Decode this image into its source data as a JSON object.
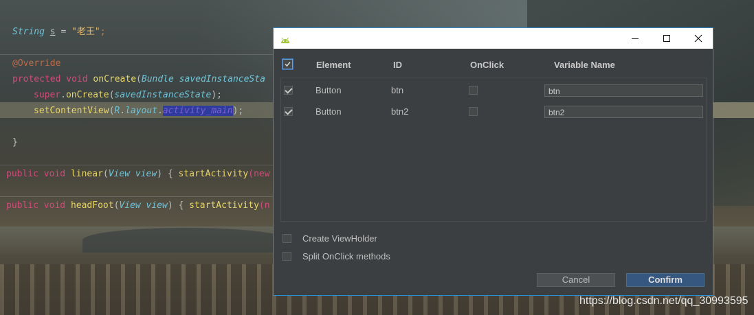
{
  "editor": {
    "line1": {
      "type": "String",
      "var": "s",
      "eq": " = ",
      "value": "\"老王\"",
      "semi": ";"
    },
    "override": "@Override",
    "line3": {
      "kw1": "protected",
      "kw2": "void",
      "fn": "onCreate",
      "paren": "(",
      "ptype": "Bundle",
      "pname": "savedInstanceSta"
    },
    "line4": {
      "kw": "super",
      "dot": ".",
      "fn": "onCreate",
      "open": "(",
      "arg": "savedInstanceState",
      "close": ");"
    },
    "line5": {
      "fn": "setContentView",
      "open": "(",
      "r": "R",
      "dot1": ".",
      "layout": "layout",
      "dot2": ".",
      "sel": "activity_main",
      "close": ");"
    },
    "brace": "}",
    "line7": {
      "kw1": "public",
      "kw2": "void",
      "fn": "linear",
      "open": "(",
      "ptype": "View",
      "pname": "view",
      "close": ")",
      "rest": " { ",
      "call": "startActivity",
      "tail": "(new"
    },
    "line8": {
      "kw1": "public",
      "kw2": "void",
      "fn": "headFoot",
      "open": "(",
      "ptype": "View",
      "pname": "view",
      "close": ")",
      "rest": " { ",
      "call": "startActivity",
      "tail": "(n"
    }
  },
  "dialog": {
    "headers": {
      "element": "Element",
      "id": "ID",
      "onclick": "OnClick",
      "variable_name": "Variable Name"
    },
    "rows": [
      {
        "element": "Button",
        "id": "btn",
        "variable_name": "btn"
      },
      {
        "element": "Button",
        "id": "btn2",
        "variable_name": "btn2"
      }
    ],
    "options": {
      "create_viewholder": "Create ViewHolder",
      "split_onclick": "Split OnClick methods"
    },
    "buttons": {
      "cancel": "Cancel",
      "confirm": "Confirm"
    }
  },
  "icons": {
    "app": "android-icon",
    "minimize": "minimize-icon",
    "maximize": "maximize-icon",
    "close": "close-icon"
  },
  "colors": {
    "dialog_border": "#2b8fd6",
    "confirm_bg": "#365880",
    "dialog_bg": "#3c3f41"
  },
  "watermark": "https://blog.csdn.net/qq_30993595"
}
